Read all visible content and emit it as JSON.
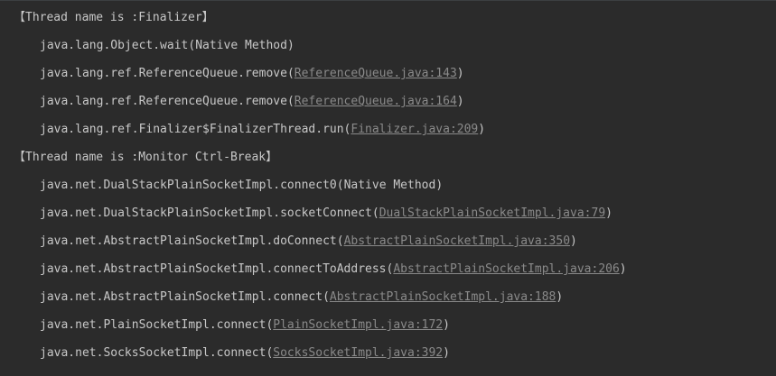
{
  "lines": [
    {
      "kind": "header",
      "text": "【Thread name is :Finalizer】"
    },
    {
      "kind": "frame",
      "method": "java.lang.Object.wait",
      "open": "(",
      "loc": "Native Method",
      "loc_is_link": false,
      "close": ")"
    },
    {
      "kind": "frame",
      "method": "java.lang.ref.ReferenceQueue.remove",
      "open": "(",
      "loc": "ReferenceQueue.java:143",
      "loc_is_link": true,
      "close": ")"
    },
    {
      "kind": "frame",
      "method": "java.lang.ref.ReferenceQueue.remove",
      "open": "(",
      "loc": "ReferenceQueue.java:164",
      "loc_is_link": true,
      "close": ")"
    },
    {
      "kind": "frame",
      "method": "java.lang.ref.Finalizer$FinalizerThread.run",
      "open": "(",
      "loc": "Finalizer.java:209",
      "loc_is_link": true,
      "close": ")"
    },
    {
      "kind": "header",
      "text": "【Thread name is :Monitor Ctrl-Break】"
    },
    {
      "kind": "frame",
      "method": "java.net.DualStackPlainSocketImpl.connect0",
      "open": "(",
      "loc": "Native Method",
      "loc_is_link": false,
      "close": ")"
    },
    {
      "kind": "frame",
      "method": "java.net.DualStackPlainSocketImpl.socketConnect",
      "open": "(",
      "loc": "DualStackPlainSocketImpl.java:79",
      "loc_is_link": true,
      "close": ")"
    },
    {
      "kind": "frame",
      "method": "java.net.AbstractPlainSocketImpl.doConnect",
      "open": "(",
      "loc": "AbstractPlainSocketImpl.java:350",
      "loc_is_link": true,
      "close": ")"
    },
    {
      "kind": "frame",
      "method": "java.net.AbstractPlainSocketImpl.connectToAddress",
      "open": "(",
      "loc": "AbstractPlainSocketImpl.java:206",
      "loc_is_link": true,
      "close": ")"
    },
    {
      "kind": "frame",
      "method": "java.net.AbstractPlainSocketImpl.connect",
      "open": "(",
      "loc": "AbstractPlainSocketImpl.java:188",
      "loc_is_link": true,
      "close": ")"
    },
    {
      "kind": "frame",
      "method": "java.net.PlainSocketImpl.connect",
      "open": "(",
      "loc": "PlainSocketImpl.java:172",
      "loc_is_link": true,
      "close": ")"
    },
    {
      "kind": "frame",
      "method": "java.net.SocksSocketImpl.connect",
      "open": "(",
      "loc": "SocksSocketImpl.java:392",
      "loc_is_link": true,
      "close": ")"
    }
  ],
  "colors": {
    "background": "#2b2b2b",
    "text": "#c8c8c8",
    "link": "#8a8a8a"
  }
}
